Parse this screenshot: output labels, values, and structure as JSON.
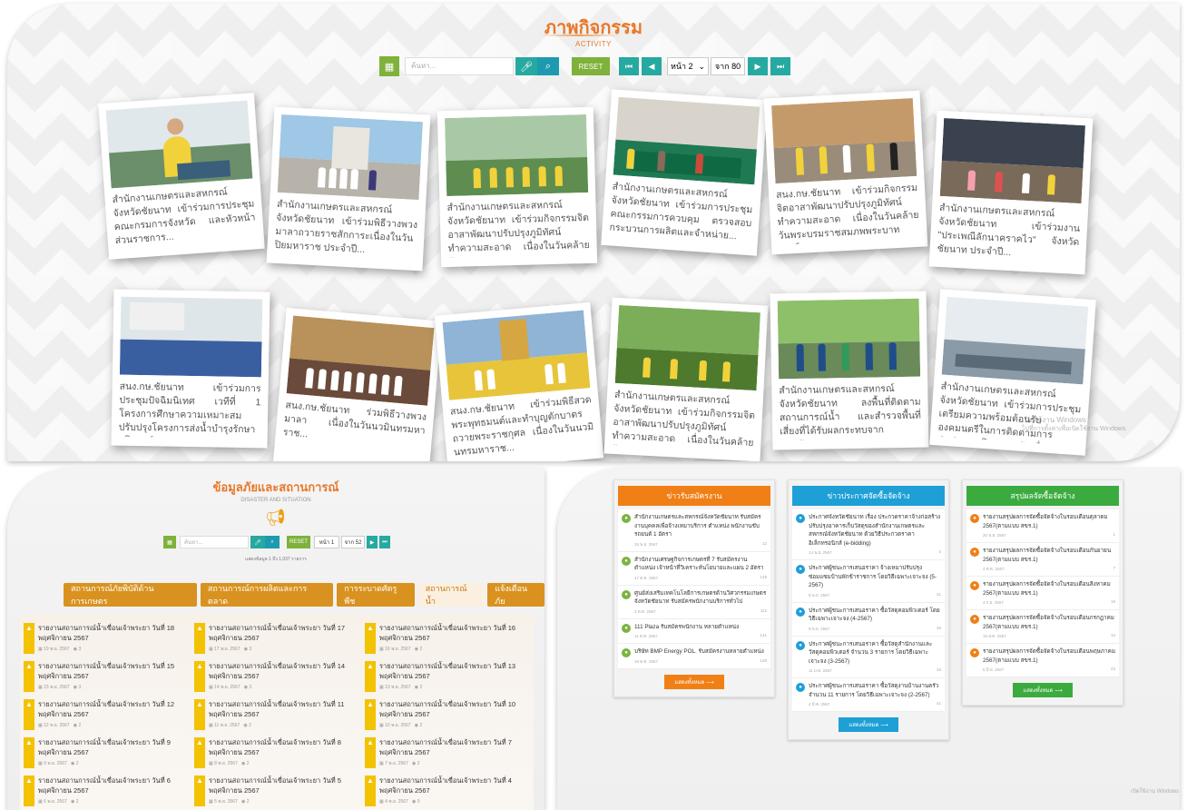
{
  "activity": {
    "title": "ภาพกิจกรรม",
    "subtitle": "ACTIVITY",
    "search_placeholder": "ค้นหา...",
    "reset_label": "RESET",
    "page_select": "หน้า 2",
    "page_of": "จาก 80",
    "cards_row1": [
      "สำนักงานเกษตรและสหกรณ์จังหวัดชัยนาท เข้าร่วมการประชุมคณะกรมการจังหวัด และหัวหน้าส่วนราชการ...",
      "สำนักงานเกษตรและสหกรณ์จังหวัดชัยนาท เข้าร่วมพิธีวางพวงมาลาถวายราชสักการะเนื่องในวันปิยมหาราช ประจำปี...",
      "สำนักงานเกษตรและสหกรณ์จังหวัดชัยนาท เข้าร่วมกิจกรรมจิตอาสาพัฒนาปรับปรุงภูมิทัศน์ ทำความสะอาด เนื่องในวันคล้ายวันสวรรคต...",
      "สำนักงานเกษตรและสหกรณ์จังหวัดชัยนาท เข้าร่วมการประชุมคณะกรรมการควบคุม ตรวจสอบกระบวนการผลิตและจำหน่าย...",
      "สนง.กษ.ชัยนาท เข้าร่วมกิจกรรมจิตอาสาพัฒนาปรับปรุงภูมิทัศน์ ทำความสะอาด เนื่องในวันคล้ายวันพระบรมราชสมภพพระบาทสมเด็จพระปร...",
      "สำนักงานเกษตรและสหกรณ์จังหวัดชัยนาท เข้าร่วมงาน \"ประเพณีลักนาคราคไว\" จังหวัดชัยนาท ประจำปี..."
    ],
    "cards_row2": [
      "สนง.กษ.ชัยนาท เข้าร่วมการประชุมปัจฉิมนิเทศ เวทีที่ 1 โครงการศึกษาความเหมาะสมปรับปรุงโครงการส่งน้ำบำรุงรักษามโนรมย์และช่อ...",
      "สนง.กษ.ชัยนาท ร่วมพิธีวางพวงมาลา เนื่องในวันนวมินทรมหาราช...",
      "สนง.กษ.ชัยนาท เข้าร่วมพิธีสวดพระพุทธมนต์และทำบุญตักบาตรถวายพระราชกุศล เนื่องในวันนวมินทรมหาราช...",
      "สำนักงานเกษตรและสหกรณ์จังหวัดชัยนาท เข้าร่วมกิจกรรมจิตอาสาพัฒนาปรับปรุงภูมิทัศน์ ทำความสะอาด เนื่องในวันคล้ายวันสวรรคต...",
      "สำนักงานเกษตรและสหกรณ์จังหวัดชัยนาท ลงพื้นที่ติดตามสถานการณ์น้ำ และสำรวจพื้นที่เสี่ยงที่ได้รับผลกระทบจากอุทกภัย...",
      "สำนักงานเกษตรและสหกรณ์จังหวัดชัยนาท เข้าร่วมการประชุมเตรียมความพร้อมต้อนรับองคมนตรีในการติดตามการดำเนินงานโครงการอันเนื่..."
    ]
  },
  "disaster": {
    "title": "ข้อมูลภัยและสถานการณ์",
    "subtitle": "DISASTER AND SITUATION",
    "search_placeholder": "ค้นหา...",
    "reset_label": "RESET",
    "page_select": "หน้า 1",
    "page_of": "จาก 52",
    "count_text": "แสดงข้อมูล 1 ถึง 1,037 รายการ",
    "tabs": [
      "สถานการณ์ภัยพิบัติด้านการเกษตร",
      "สถานการณ์การผลิตและการตลาด",
      "การระบาดศัตรูพืช",
      "สถานการณ์น้ำ",
      "แจ้งเตือนภัย"
    ],
    "items": [
      {
        "title": "รายงานสถานการณ์น้ำเขื่อนเจ้าพระยา วันที่ 18 พฤศจิกายน 2567",
        "date": "19 พ.ย. 2567",
        "views": "3"
      },
      {
        "title": "รายงานสถานการณ์น้ำเขื่อนเจ้าพระยา วันที่ 17 พฤศจิกายน 2567",
        "date": "17 พ.ย. 2567",
        "views": "3"
      },
      {
        "title": "รายงานสถานการณ์น้ำเขื่อนเจ้าพระยา วันที่ 16 พฤศจิกายน 2567",
        "date": "16 พ.ย. 2567",
        "views": "2"
      },
      {
        "title": "รายงานสถานการณ์น้ำเขื่อนเจ้าพระยา วันที่ 15 พฤศจิกายน 2567",
        "date": "15 พ.ย. 2567",
        "views": "3"
      },
      {
        "title": "รายงานสถานการณ์น้ำเขื่อนเจ้าพระยา วันที่ 14 พฤศจิกายน 2567",
        "date": "14 พ.ย. 2567",
        "views": "3"
      },
      {
        "title": "รายงานสถานการณ์น้ำเขื่อนเจ้าพระยา วันที่ 13 พฤศจิกายน 2567",
        "date": "13 พ.ย. 2567",
        "views": "2"
      },
      {
        "title": "รายงานสถานการณ์น้ำเขื่อนเจ้าพระยา วันที่ 12 พฤศจิกายน 2567",
        "date": "12 พ.ย. 2567",
        "views": "2"
      },
      {
        "title": "รายงานสถานการณ์น้ำเขื่อนเจ้าพระยา วันที่ 11 พฤศจิกายน 2567",
        "date": "11 พ.ย. 2567",
        "views": "2"
      },
      {
        "title": "รายงานสถานการณ์น้ำเขื่อนเจ้าพระยา วันที่ 10 พฤศจิกายน 2567",
        "date": "10 พ.ย. 2567",
        "views": "2"
      },
      {
        "title": "รายงานสถานการณ์น้ำเขื่อนเจ้าพระยา วันที่ 9 พฤศจิกายน 2567",
        "date": "9 พ.ย. 2567",
        "views": "2"
      },
      {
        "title": "รายงานสถานการณ์น้ำเขื่อนเจ้าพระยา วันที่ 8 พฤศจิกายน 2567",
        "date": "8 พ.ย. 2567",
        "views": "2"
      },
      {
        "title": "รายงานสถานการณ์น้ำเขื่อนเจ้าพระยา วันที่ 7 พฤศจิกายน 2567",
        "date": "7 พ.ย. 2567",
        "views": "2"
      },
      {
        "title": "รายงานสถานการณ์น้ำเขื่อนเจ้าพระยา วันที่ 6 พฤศจิกายน 2567",
        "date": "6 พ.ย. 2567",
        "views": "2"
      },
      {
        "title": "รายงานสถานการณ์น้ำเขื่อนเจ้าพระยา วันที่ 5 พฤศจิกายน 2567",
        "date": "5 พ.ย. 2567",
        "views": "2"
      },
      {
        "title": "รายงานสถานการณ์น้ำเขื่อนเจ้าพระยา วันที่ 4 พฤศจิกายน 2567",
        "date": "4 พ.ย. 2567",
        "views": "0"
      }
    ]
  },
  "columns": [
    {
      "header": "ข่าวรับสมัครงาน",
      "color": "#f07f16",
      "icon_color": "#7cb342",
      "button": "แสดงทั้งหมด ⟶",
      "items": [
        {
          "title": "สำนักงานเกษตรและสหกรณ์จังหวัดชัยนาท รับสมัครงานบุคคลเพื่อจ้างเหมาบริการ ตำแหน่ง พนักงานขับรถยนต์ 1 อัตรา",
          "date": "15 พ.ย. 2567",
          "views": "12"
        },
        {
          "title": "สำนักงานเศรษฐกิจการเกษตรที่ 7 รับสมัครงานตำแหน่ง เจ้าหน้าที่วิเคราะห์นโยบายและแผน 2 อัตรา",
          "date": "17 ต.ค. 2567",
          "views": "149"
        },
        {
          "title": "ศูนย์ส่งเสริมเทคโนโลยีการเกษตรด้านวิศวกรรมเกษตร จังหวัดชัยนาท รับสมัครพนักงานบริการทั่วไป",
          "date": "3 ต.ค. 2567",
          "views": "112"
        },
        {
          "title": "111 Plaza รับสมัครพนักงาน หลายตำแหน่ง",
          "date": "11 ต.ค. 2567",
          "views": "141"
        },
        {
          "title": "บริษัท BMP Energy POL. รับสมัครงานหลายตำแหน่ง",
          "date": "19 ต.ค. 2567",
          "views": "129"
        }
      ]
    },
    {
      "header": "ข่าวประกาศจัดซื้อจัดจ้าง",
      "color": "#1e9fd6",
      "icon_color": "#1e9fd6",
      "button": "แสดงทั้งหมด ⟶",
      "items": [
        {
          "title": "ประกาศจังหวัดชัยนาท เรื่อง ประกวดราคาจ้างก่อสร้างปรับปรุงอาคารเก็บวัสดุของสำนักงานเกษตรและสหกรณ์จังหวัดชัยนาท ด้วยวิธีประกวดราคาอิเล็กทรอนิกส์ (e-bidding)",
          "date": "14 พ.ย. 2567",
          "views": "3"
        },
        {
          "title": "ประกาศผู้ชนะการเสนอราคา จ้างเหมาปรับปรุงซ่อมแซมบ้านพักข้าราชการ โดยวิธีเฉพาะเจาะจง (5-2567)",
          "date": "9 พ.ย. 2567",
          "views": "31"
        },
        {
          "title": "ประกาศผู้ชนะการเสนอราคา ซื้อวัสดุคอมพิวเตอร์ โดยวิธีเฉพาะเจาะจง (4-2567)",
          "date": "9 พ.ย. 2567",
          "views": "26"
        },
        {
          "title": "ประกาศผู้ชนะการเสนอราคา ซื้อวัสดุสำนักงานและวัสดุคอมพิวเตอร์ จำนวน 3 รายการ โดยวิธีเฉพาะเจาะจง (3-2567)",
          "date": "11 ม.ค. 2567",
          "views": "33"
        },
        {
          "title": "ประกาศผู้ชนะการเสนอราคา ซื้อวัสดุงานบ้านงานครัว จำนวน 11 รายการ โดยวิธีเฉพาะเจาะจง (2-2567)",
          "date": "4 มี.ค. 2567",
          "views": "41"
        }
      ]
    },
    {
      "header": "สรุปผลจัดซื้อจัดจ้าง",
      "color": "#3bab3f",
      "icon_color": "#f07f16",
      "button": "แสดงทั้งหมด ⟶",
      "items": [
        {
          "title": "รายงานสรุปผลการจัดซื้อจัดจ้างในรอบเดือนตุลาคม 2567(ตามแบบ สขร.1)",
          "date": "20 พ.ย. 2567",
          "views": "1"
        },
        {
          "title": "รายงานสรุปผลการจัดซื้อจัดจ้างในรอบเดือนกันยายน 2567(ตามแบบ สขร.1)",
          "date": "4 ต.ค. 2567",
          "views": "7"
        },
        {
          "title": "รายงานสรุปผลการจัดซื้อจัดจ้างในรอบเดือนสิงหาคม 2567(ตามแบบ สขร.1)",
          "date": "4 ก.ย. 2567",
          "views": "18"
        },
        {
          "title": "รายงานสรุปผลการจัดซื้อจัดจ้างในรอบเดือนกรกฎาคม 2567(ตามแบบ สขร.1)",
          "date": "16 ส.ค. 2567",
          "views": "10"
        },
        {
          "title": "รายงานสรุปผลการจัดซื้อจัดจ้างในรอบเดือนพฤษภาคม 2567(ตามแบบ สขร.1)",
          "date": "5 มิ.ย. 2567",
          "views": "23"
        }
      ]
    }
  ],
  "watermark": {
    "line1": "เปิดใช้งาน Windows",
    "line2": "ไปที่การตั้งค่าเพื่อเปิดใช้งาน Windows"
  }
}
